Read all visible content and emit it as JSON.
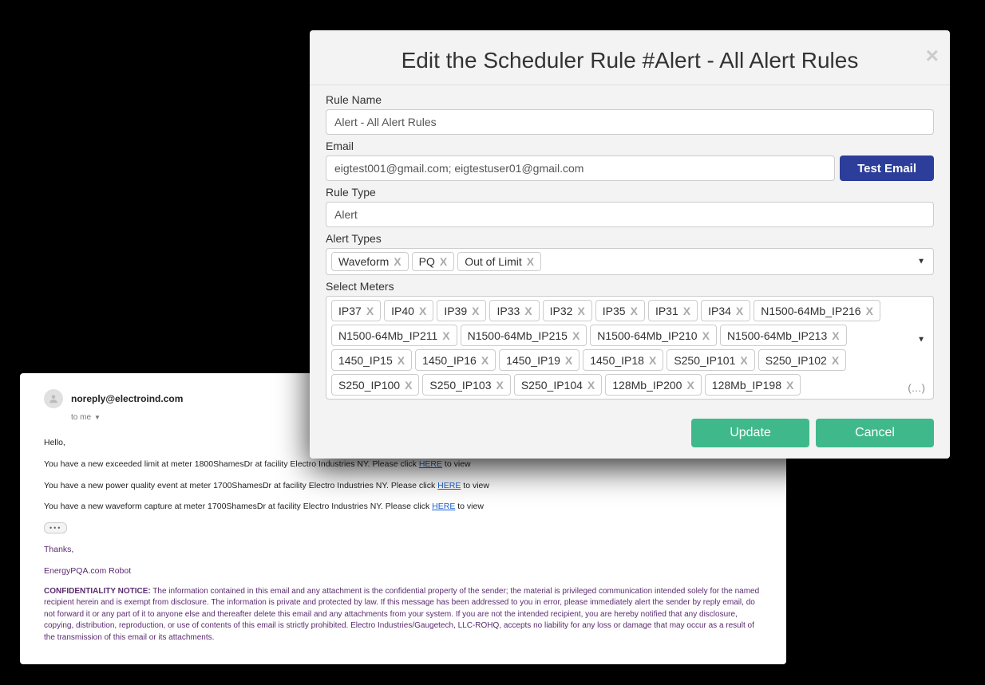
{
  "modal": {
    "title": "Edit the Scheduler Rule #Alert - All Alert Rules",
    "labels": {
      "rule_name": "Rule Name",
      "email": "Email",
      "rule_type": "Rule Type",
      "alert_types": "Alert Types",
      "select_meters": "Select Meters"
    },
    "values": {
      "rule_name": "Alert - All Alert Rules",
      "email": "eigtest001@gmail.com; eigtestuser01@gmail.com",
      "rule_type": "Alert"
    },
    "buttons": {
      "test_email": "Test Email",
      "update": "Update",
      "cancel": "Cancel"
    },
    "alert_types": [
      "Out of Limit",
      "PQ",
      "Waveform"
    ],
    "meters": [
      "IP37",
      "IP40",
      "IP39",
      "IP33",
      "IP32",
      "IP35",
      "IP31",
      "IP34",
      "N1500-64Mb_IP216",
      "N1500-64Mb_IP211",
      "N1500-64Mb_IP215",
      "N1500-64Mb_IP210",
      "N1500-64Mb_IP213",
      "1450_IP15",
      "1450_IP16",
      "1450_IP19",
      "1450_IP18",
      "S250_IP101",
      "S250_IP102",
      "S250_IP100",
      "S250_IP103",
      "S250_IP104",
      "128Mb_IP200",
      "128Mb_IP198"
    ],
    "overflow_hint": "(…)"
  },
  "email": {
    "from": "noreply@electroind.com",
    "to_label": "to me",
    "greeting": "Hello,",
    "lines": [
      {
        "pre": "You have a new exceeded limit at meter 1800ShamesDr at facility Electro Industries NY. Please click ",
        "link": "HERE",
        "post": " to view"
      },
      {
        "pre": "You have a new power quality event at meter 1700ShamesDr at facility Electro Industries NY. Please click ",
        "link": "HERE",
        "post": " to view"
      },
      {
        "pre": "You have a new waveform capture at meter 1700ShamesDr at facility Electro Industries NY. Please click ",
        "link": "HERE",
        "post": " to view"
      }
    ],
    "thanks": "Thanks,",
    "robot": "EnergyPQA.com Robot",
    "conf_heading": "CONFIDENTIALITY NOTICE:",
    "conf_body": " The information contained in this email and any attachment is the confidential property of the sender; the material is privileged communication intended solely for the named recipient herein and is exempt from disclosure. The information is private and protected by law. If this message has been addressed to you in error, please immediately alert the sender by reply email, do not forward it or any part of it to anyone else and thereafter delete this email and any attachments from your system. If you are not the intended recipient, you are hereby notified that any disclosure, copying, distribution, reproduction, or use of contents of this email is strictly prohibited. Electro Industries/Gaugetech, LLC-ROHQ, accepts no liability for any loss or damage that may occur as a result of the transmission of this email or its attachments."
  }
}
